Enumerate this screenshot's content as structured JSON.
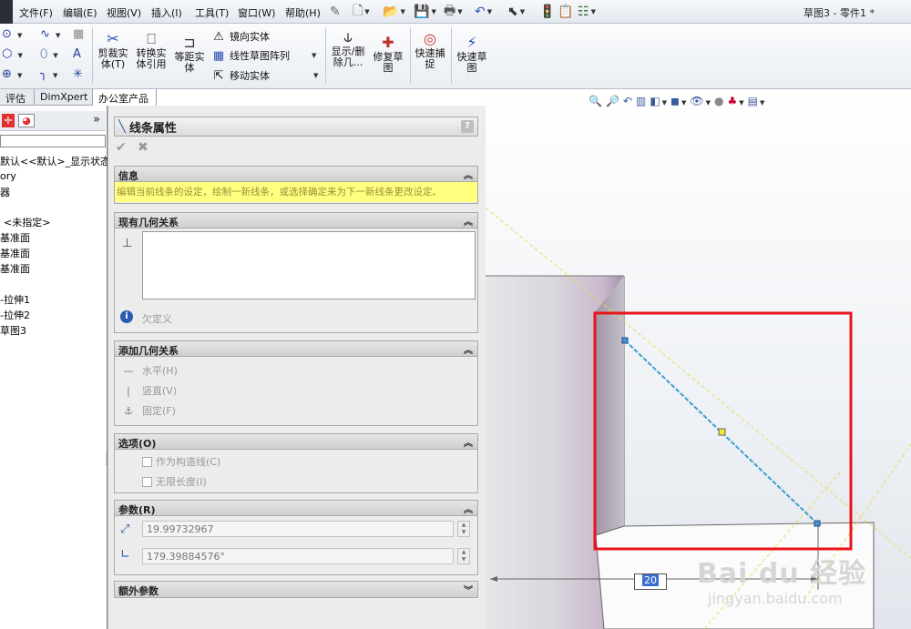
{
  "menu": [
    "文件(F)",
    "编辑(E)",
    "视图(V)",
    "插入(I)",
    "工具(T)",
    "窗口(W)",
    "帮助(H)"
  ],
  "document_title": "草图3 - 零件1 *",
  "ribbon": {
    "trim": "剪裁实\n体(T)",
    "convert": "转换实\n体引用",
    "offset": "等距实\n体",
    "mirror": "镜向实体",
    "linear_pattern": "线性草图阵列",
    "move": "移动实体",
    "show_delete": "显示/删\n除几...",
    "repair": "修复草\n图",
    "quick_snap": "快速捕\n捉",
    "rapid_sketch": "快速草\n图"
  },
  "tabs": [
    "评估",
    "DimXpert",
    "办公室产品"
  ],
  "tree": [
    "默认<<默认>_显示状态",
    "ory",
    "器",
    "<未指定>",
    "基准面",
    "基准面",
    "基准面",
    "-拉伸1",
    "-拉伸2",
    "草图3"
  ],
  "pm": {
    "title": "线条属性",
    "help": "?",
    "info_title": "信息",
    "info_text": "编辑当前线条的设定，绘制一新线条，或选择确定来为下一新线条更改设定。",
    "existing_title": "现有几何关系",
    "status": "欠定义",
    "add_title": "添加几何关系",
    "horizontal": "水平(H)",
    "vertical": "竖直(V)",
    "fixed": "固定(F)",
    "options_title": "选项(O)",
    "construction": "作为构造线(C)",
    "infinite": "无限长度(I)",
    "params_title": "参数(R)",
    "length": "19.99732967",
    "angle": "179.39884576°",
    "extra_title": "额外参数"
  },
  "dimension": "20",
  "watermark": {
    "brand": "Bai du 经验",
    "url": "jingyan.baidu.com"
  },
  "colors": {
    "highlight": "#e8141c",
    "line": "#3aa0d0",
    "info_bg": "#ffff80"
  }
}
